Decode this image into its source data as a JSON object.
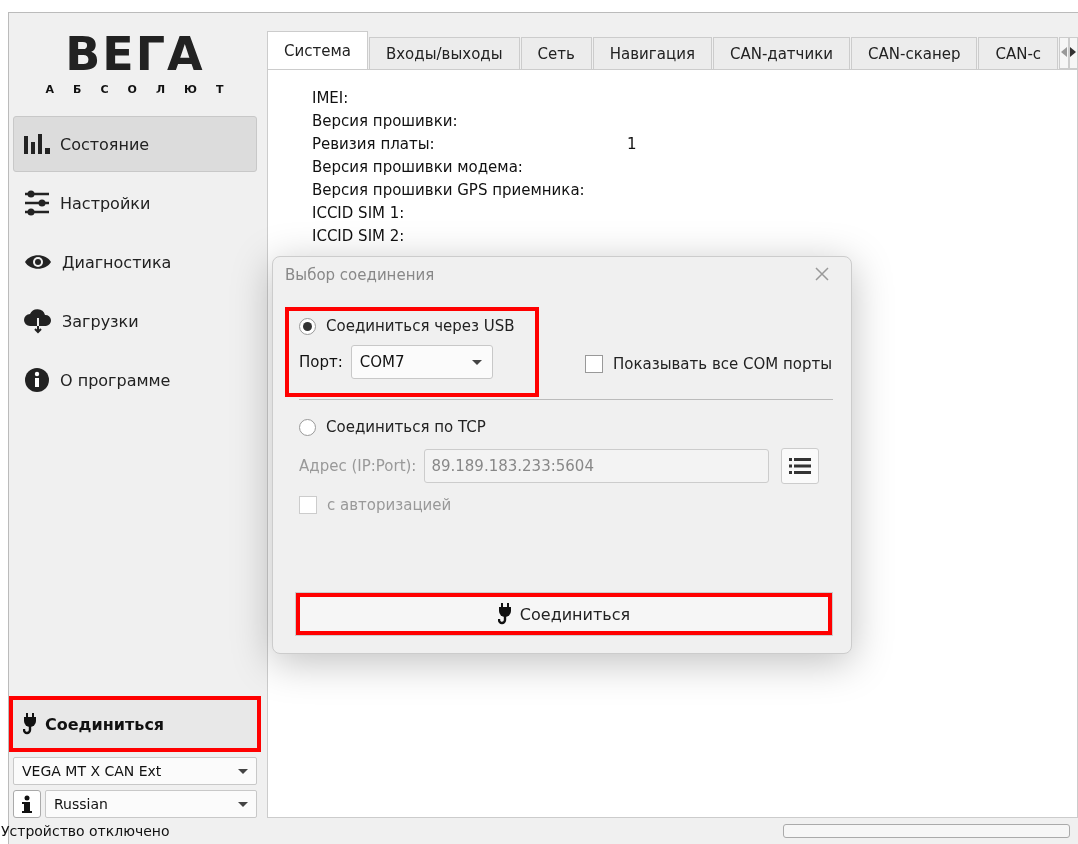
{
  "sidebar": {
    "logo": "ВЕГА",
    "logo_subtitle": "АБСОЛЮТ",
    "items": [
      {
        "label": "Состояние",
        "selected": true
      },
      {
        "label": "Настройки",
        "selected": false
      },
      {
        "label": "Диагностика",
        "selected": false
      },
      {
        "label": "Загрузки",
        "selected": false
      },
      {
        "label": "О программе",
        "selected": false
      }
    ],
    "connect_button": "Соединиться",
    "device_select": "VEGA MT X CAN Ext",
    "language_select": "Russian"
  },
  "tabs": [
    {
      "label": "Система",
      "selected": true
    },
    {
      "label": "Входы/выходы",
      "selected": false
    },
    {
      "label": "Сеть",
      "selected": false
    },
    {
      "label": "Навигация",
      "selected": false
    },
    {
      "label": "CAN-датчики",
      "selected": false
    },
    {
      "label": "CAN-сканер",
      "selected": false
    },
    {
      "label": "CAN-с",
      "selected": false
    }
  ],
  "info_rows": [
    {
      "label": "IMEI:"
    },
    {
      "label": "Версия прошивки:"
    },
    {
      "label": "Ревизия платы:",
      "value": "1"
    },
    {
      "label": "Версия прошивки модема:"
    },
    {
      "label": "Версия прошивки GPS приемника:"
    },
    {
      "label": "ICCID SIM 1:"
    },
    {
      "label": "ICCID SIM 2:"
    }
  ],
  "dialog": {
    "title": "Выбор соединения",
    "usb": {
      "label": "Соединиться через USB",
      "selected": true,
      "port_label": "Порт:",
      "port_value": "COM7",
      "show_all_label": "Показывать все COM порты",
      "show_all_checked": false
    },
    "tcp": {
      "label": "Соединиться по TCP",
      "selected": false,
      "address_label": "Адрес (IP:Port):",
      "address_value": "89.189.183.233:5604",
      "auth_label": "с авторизацией",
      "auth_checked": false,
      "disabled": true
    },
    "connect_button": "Соединиться"
  },
  "status_bar": {
    "text": "Устройство отключено",
    "level": 0
  }
}
